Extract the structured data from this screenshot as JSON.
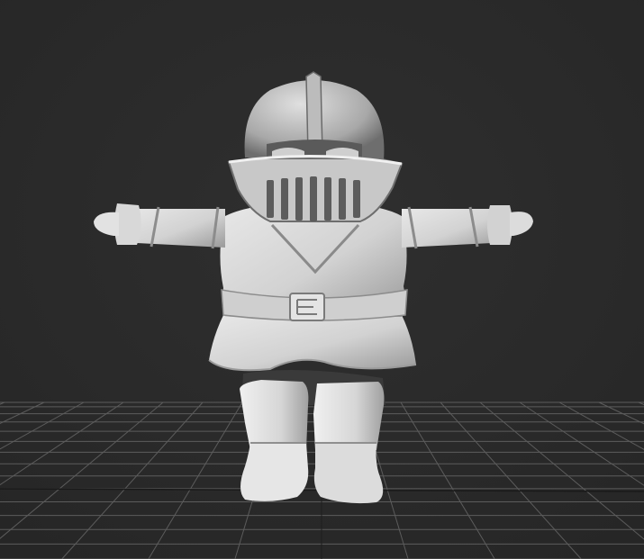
{
  "viewport": {
    "view": "perspective",
    "shading": "default-shading",
    "background_color": "#2b2b2b",
    "grid_color": "#5a5a5a",
    "model_color": "#d9d9d9"
  },
  "model": {
    "subject": "knight-character",
    "pose": "t-pose"
  }
}
